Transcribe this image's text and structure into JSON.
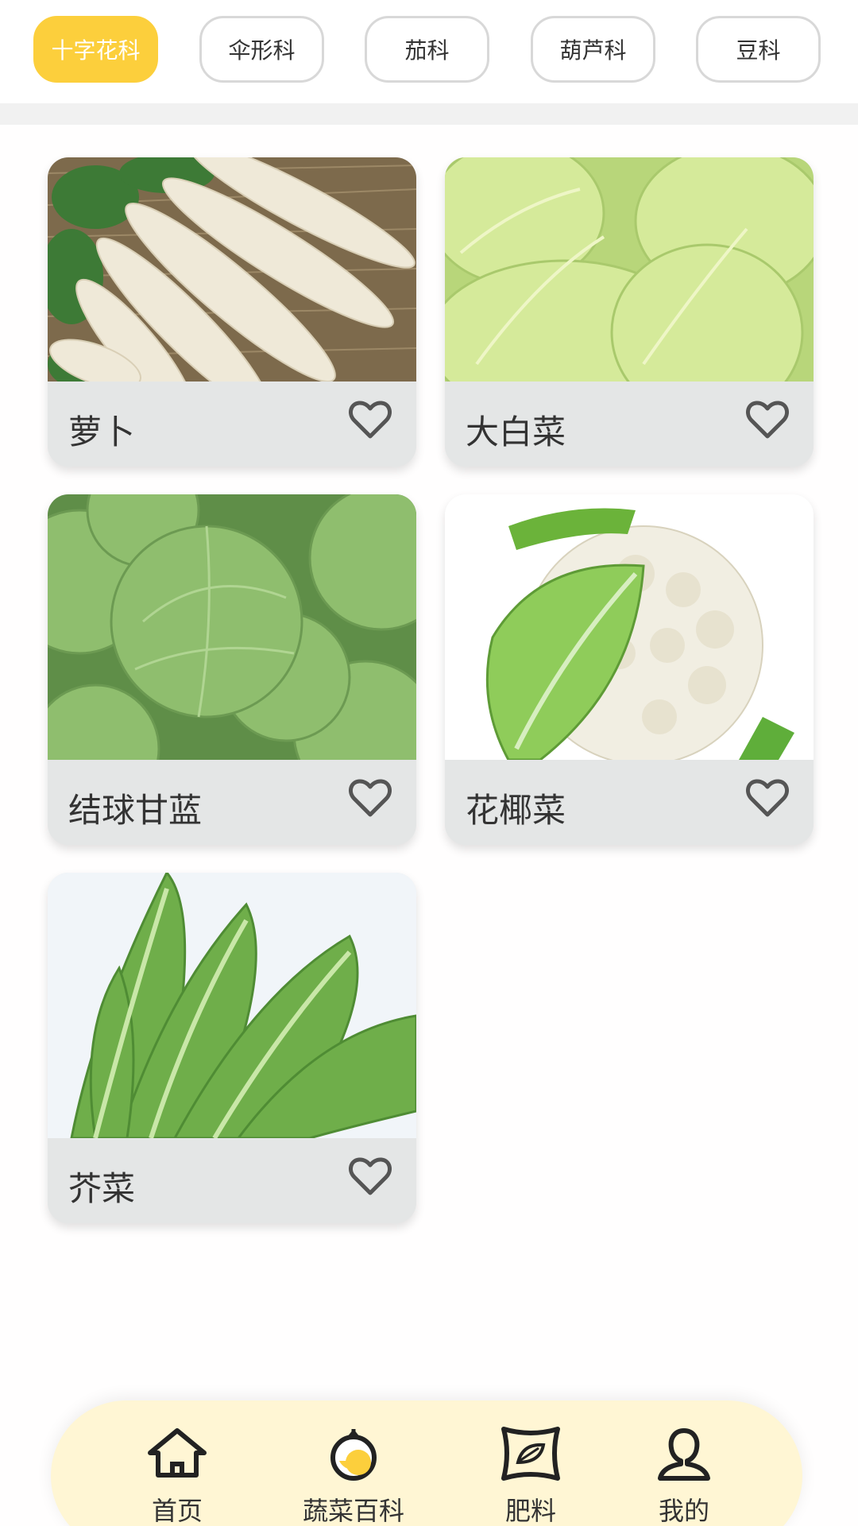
{
  "tabs": [
    {
      "label": "十字花科",
      "active": true
    },
    {
      "label": "伞形科",
      "active": false
    },
    {
      "label": "茄科",
      "active": false
    },
    {
      "label": "葫芦科",
      "active": false
    },
    {
      "label": "豆科",
      "active": false
    }
  ],
  "vegetables": [
    {
      "name": "萝卜"
    },
    {
      "name": "大白菜"
    },
    {
      "name": "结球甘蓝"
    },
    {
      "name": "花椰菜"
    },
    {
      "name": "芥菜"
    }
  ],
  "nav": [
    {
      "label": "首页",
      "icon": "home-icon"
    },
    {
      "label": "蔬菜百科",
      "icon": "vegetable-icon"
    },
    {
      "label": "肥料",
      "icon": "fertilizer-bag-icon"
    },
    {
      "label": "我的",
      "icon": "user-icon"
    }
  ],
  "colors": {
    "accent": "#fccf3c",
    "card_bg": "#e4e6e6",
    "nav_bg": "#fff6d4"
  }
}
